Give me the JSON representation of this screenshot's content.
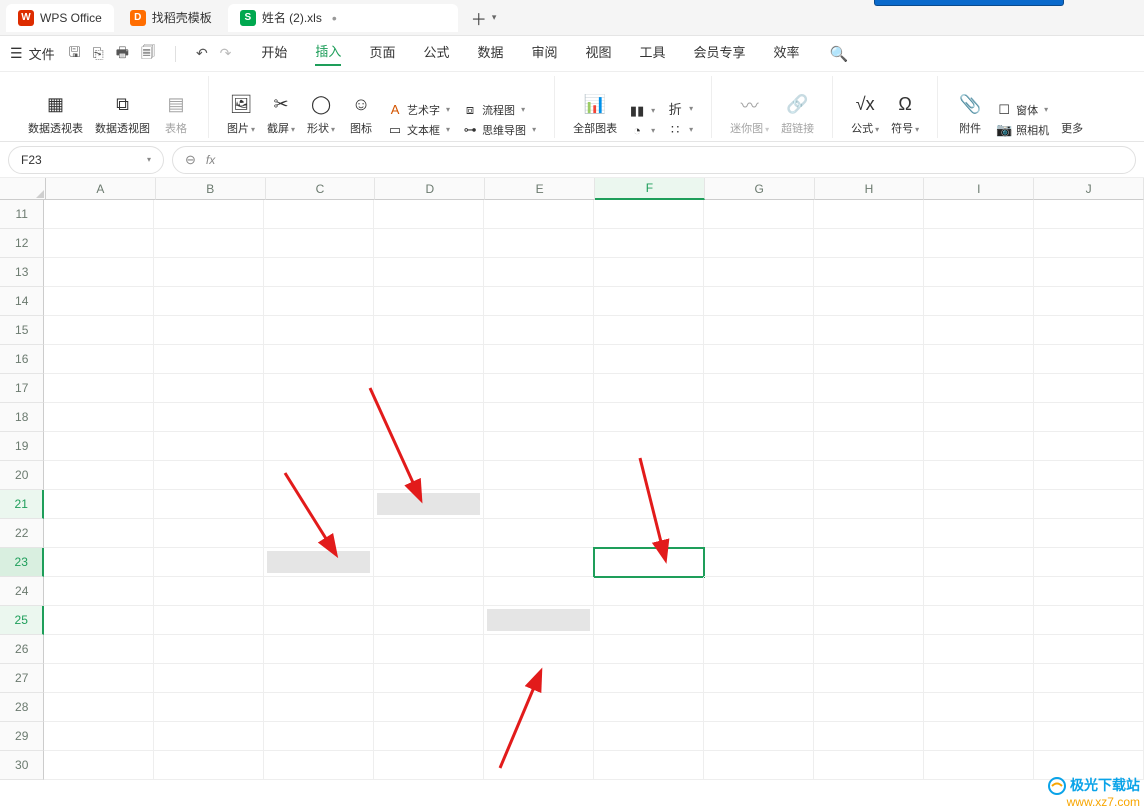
{
  "tabs": {
    "home": "WPS Office",
    "tpl": "找稻壳模板",
    "doc": "姓名 (2).xls"
  },
  "menubar": {
    "file": "文件",
    "items": [
      "开始",
      "插入",
      "页面",
      "公式",
      "数据",
      "审阅",
      "视图",
      "工具",
      "会员专享",
      "效率"
    ],
    "active_index": 1
  },
  "ribbon": {
    "pivotTable": "数据透视表",
    "pivotChart": "数据透视图",
    "table": "表格",
    "picture": "图片",
    "screenshot": "截屏",
    "shape": "形状",
    "icon": "图标",
    "wordart": "艺术字",
    "flowchart": "流程图",
    "textbox": "文本框",
    "mindmap": "思维导图",
    "allCharts": "全部图表",
    "sparkline": "迷你图",
    "hyperlink": "超链接",
    "formula": "公式",
    "symbol": "符号",
    "attachment": "附件",
    "window": "窗体",
    "camera": "照相机",
    "more": "更多"
  },
  "namebox": "F23",
  "cols": [
    "A",
    "B",
    "C",
    "D",
    "E",
    "F",
    "G",
    "H",
    "I",
    "J"
  ],
  "active_col": "F",
  "rows_start": 11,
  "rows_end": 30,
  "active_row": 23,
  "hl_rows": [
    21,
    25
  ],
  "gray_cells": [
    {
      "r": 21,
      "c": "D"
    },
    {
      "r": 23,
      "c": "C"
    },
    {
      "r": 25,
      "c": "E"
    }
  ],
  "sel_cell": {
    "r": 23,
    "c": "F"
  },
  "watermark": {
    "l1": "极光下载站",
    "l2": "www.xz7.com"
  }
}
